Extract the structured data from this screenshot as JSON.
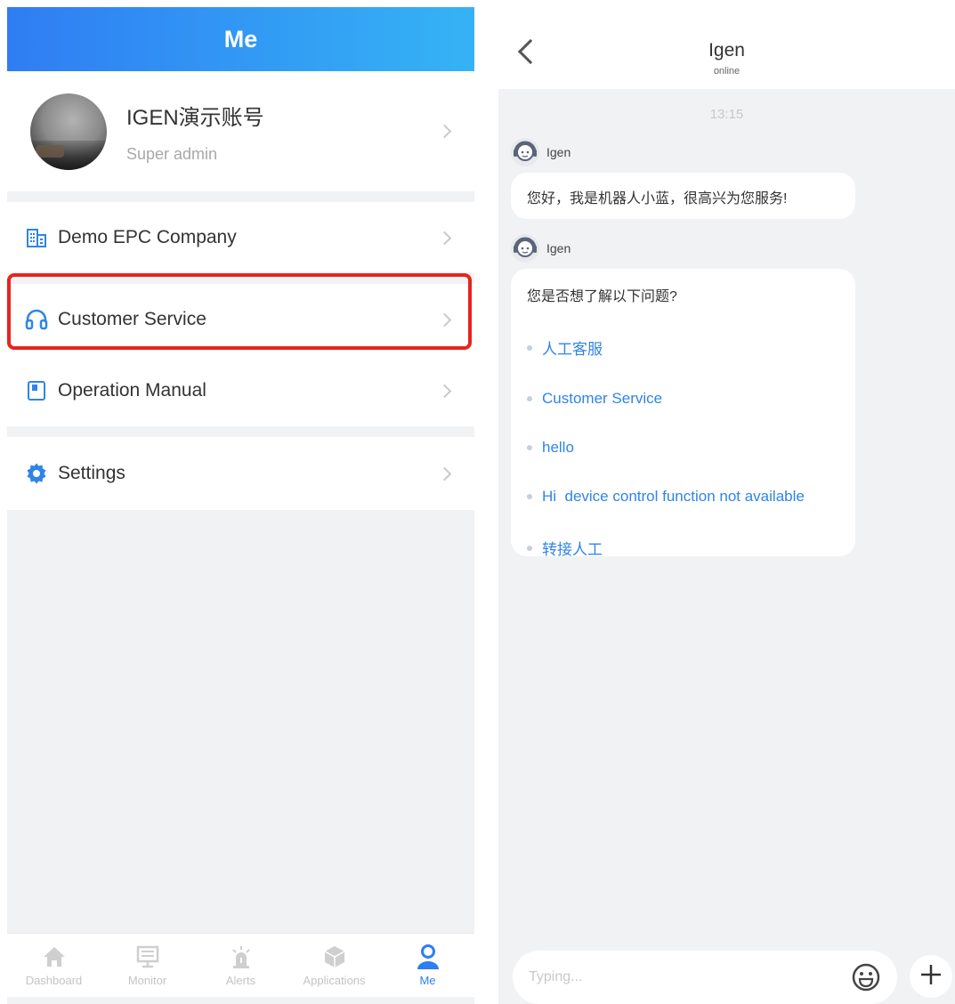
{
  "me_screen": {
    "title": "Me",
    "profile": {
      "name": "IGEN演示账号",
      "role": "Super admin"
    },
    "menu": {
      "company": "Demo EPC Company",
      "customer_service": "Customer Service",
      "operation_manual": "Operation Manual",
      "settings": "Settings"
    },
    "tabs": [
      {
        "label": "Dashboard",
        "icon": "home-icon"
      },
      {
        "label": "Monitor",
        "icon": "monitor-icon"
      },
      {
        "label": "Alerts",
        "icon": "siren-icon"
      },
      {
        "label": "Applications",
        "icon": "cube-icon"
      },
      {
        "label": "Me",
        "icon": "user-icon",
        "active": true
      }
    ],
    "accent_color": "#2f7df3",
    "highlight_color": "#e8231f"
  },
  "chat_screen": {
    "title": "Igen",
    "status": "online",
    "timestamp": "13:15",
    "messages": [
      {
        "sender": "Igen",
        "text": "您好，我是机器人小蓝，很高兴为您服务!"
      },
      {
        "sender": "Igen",
        "text": "您是否想了解以下问题?",
        "options": [
          "人工客服",
          "Customer Service",
          "hello",
          "Hi  device control function not available",
          "转接人工"
        ]
      }
    ],
    "input_placeholder": "Typing..."
  }
}
